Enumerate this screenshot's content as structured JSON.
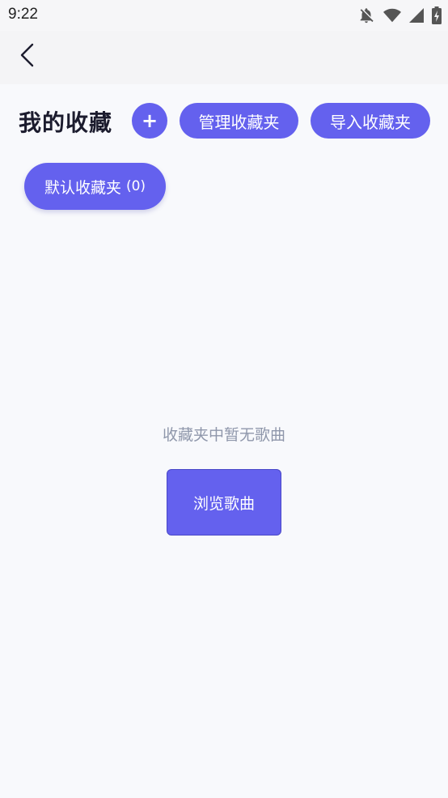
{
  "status_bar": {
    "time": "9:22",
    "icons": [
      "bell-off-icon",
      "wifi-icon",
      "signal-icon",
      "battery-charging-icon"
    ]
  },
  "app_bar": {
    "back_icon": "chevron-left-icon"
  },
  "header": {
    "title": "我的收藏",
    "add_label": "+",
    "manage_label": "管理收藏夹",
    "import_label": "导入收藏夹"
  },
  "folders": [
    {
      "name": "默认收藏夹",
      "count": "(0)"
    }
  ],
  "empty_state": {
    "message": "收藏夹中暂无歌曲",
    "browse_label": "浏览歌曲"
  },
  "colors": {
    "accent": "#6461ee",
    "background": "#f8f9fc",
    "muted_text": "#8f97ab",
    "title_text": "#1c1c2e"
  }
}
